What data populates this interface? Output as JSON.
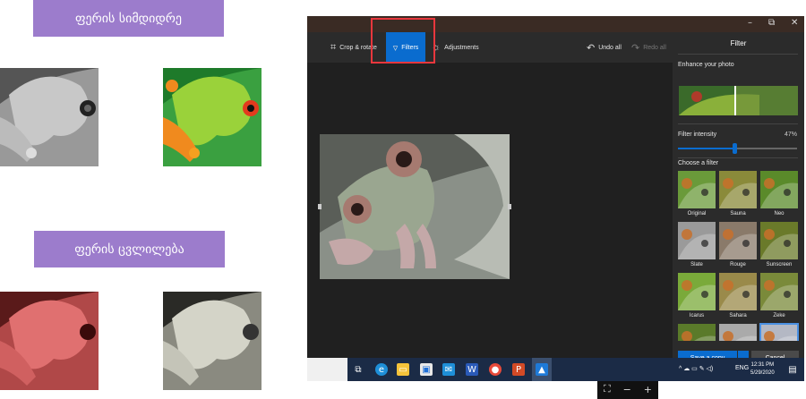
{
  "labels": {
    "color_enrich": "ფერის სიმდიდრე",
    "color_change": "ფერის ცვლილება"
  },
  "window": {
    "controls": {
      "minimize": "–",
      "maximize": "⧉",
      "close": "✕"
    }
  },
  "toolbar": {
    "crop_label": "Crop & rotate",
    "filters_label": "Filters",
    "adjustments_label": "Adjustments",
    "undo_label": "Undo all",
    "redo_label": "Redo all"
  },
  "panel": {
    "title": "Filter",
    "enhance_label": "Enhance your photo",
    "intensity_label": "Filter intensity",
    "intensity_value": "47%",
    "intensity_fraction": 0.47,
    "choose_label": "Choose a filter",
    "filters": [
      {
        "name": "Original",
        "tone": "#6a9a3a"
      },
      {
        "name": "Sauna",
        "tone": "#8a8a3a"
      },
      {
        "name": "Neo",
        "tone": "#5a8a2a"
      },
      {
        "name": "Slate",
        "tone": "#9a9a9a"
      },
      {
        "name": "Rouge",
        "tone": "#8a7a6a"
      },
      {
        "name": "Sunscreen",
        "tone": "#6a7a2a"
      },
      {
        "name": "Icarus",
        "tone": "#7aaa3a"
      },
      {
        "name": "Sahara",
        "tone": "#9a8a4a"
      },
      {
        "name": "Zeke",
        "tone": "#7a8a3a"
      },
      {
        "name": "",
        "tone": "#5a7a2a"
      },
      {
        "name": "",
        "tone": "#aaaaaa"
      },
      {
        "name": "",
        "tone": "#b4b8c4"
      }
    ],
    "save_label": "Save a copy",
    "cancel_label": "Cancel"
  },
  "taskbar": {
    "language": "ENG",
    "time": "12:31 PM",
    "date": "5/29/2020"
  },
  "colors": {
    "accent": "#0a6ccf",
    "banner": "#9c7ccc",
    "highlight": "#e8373d"
  }
}
